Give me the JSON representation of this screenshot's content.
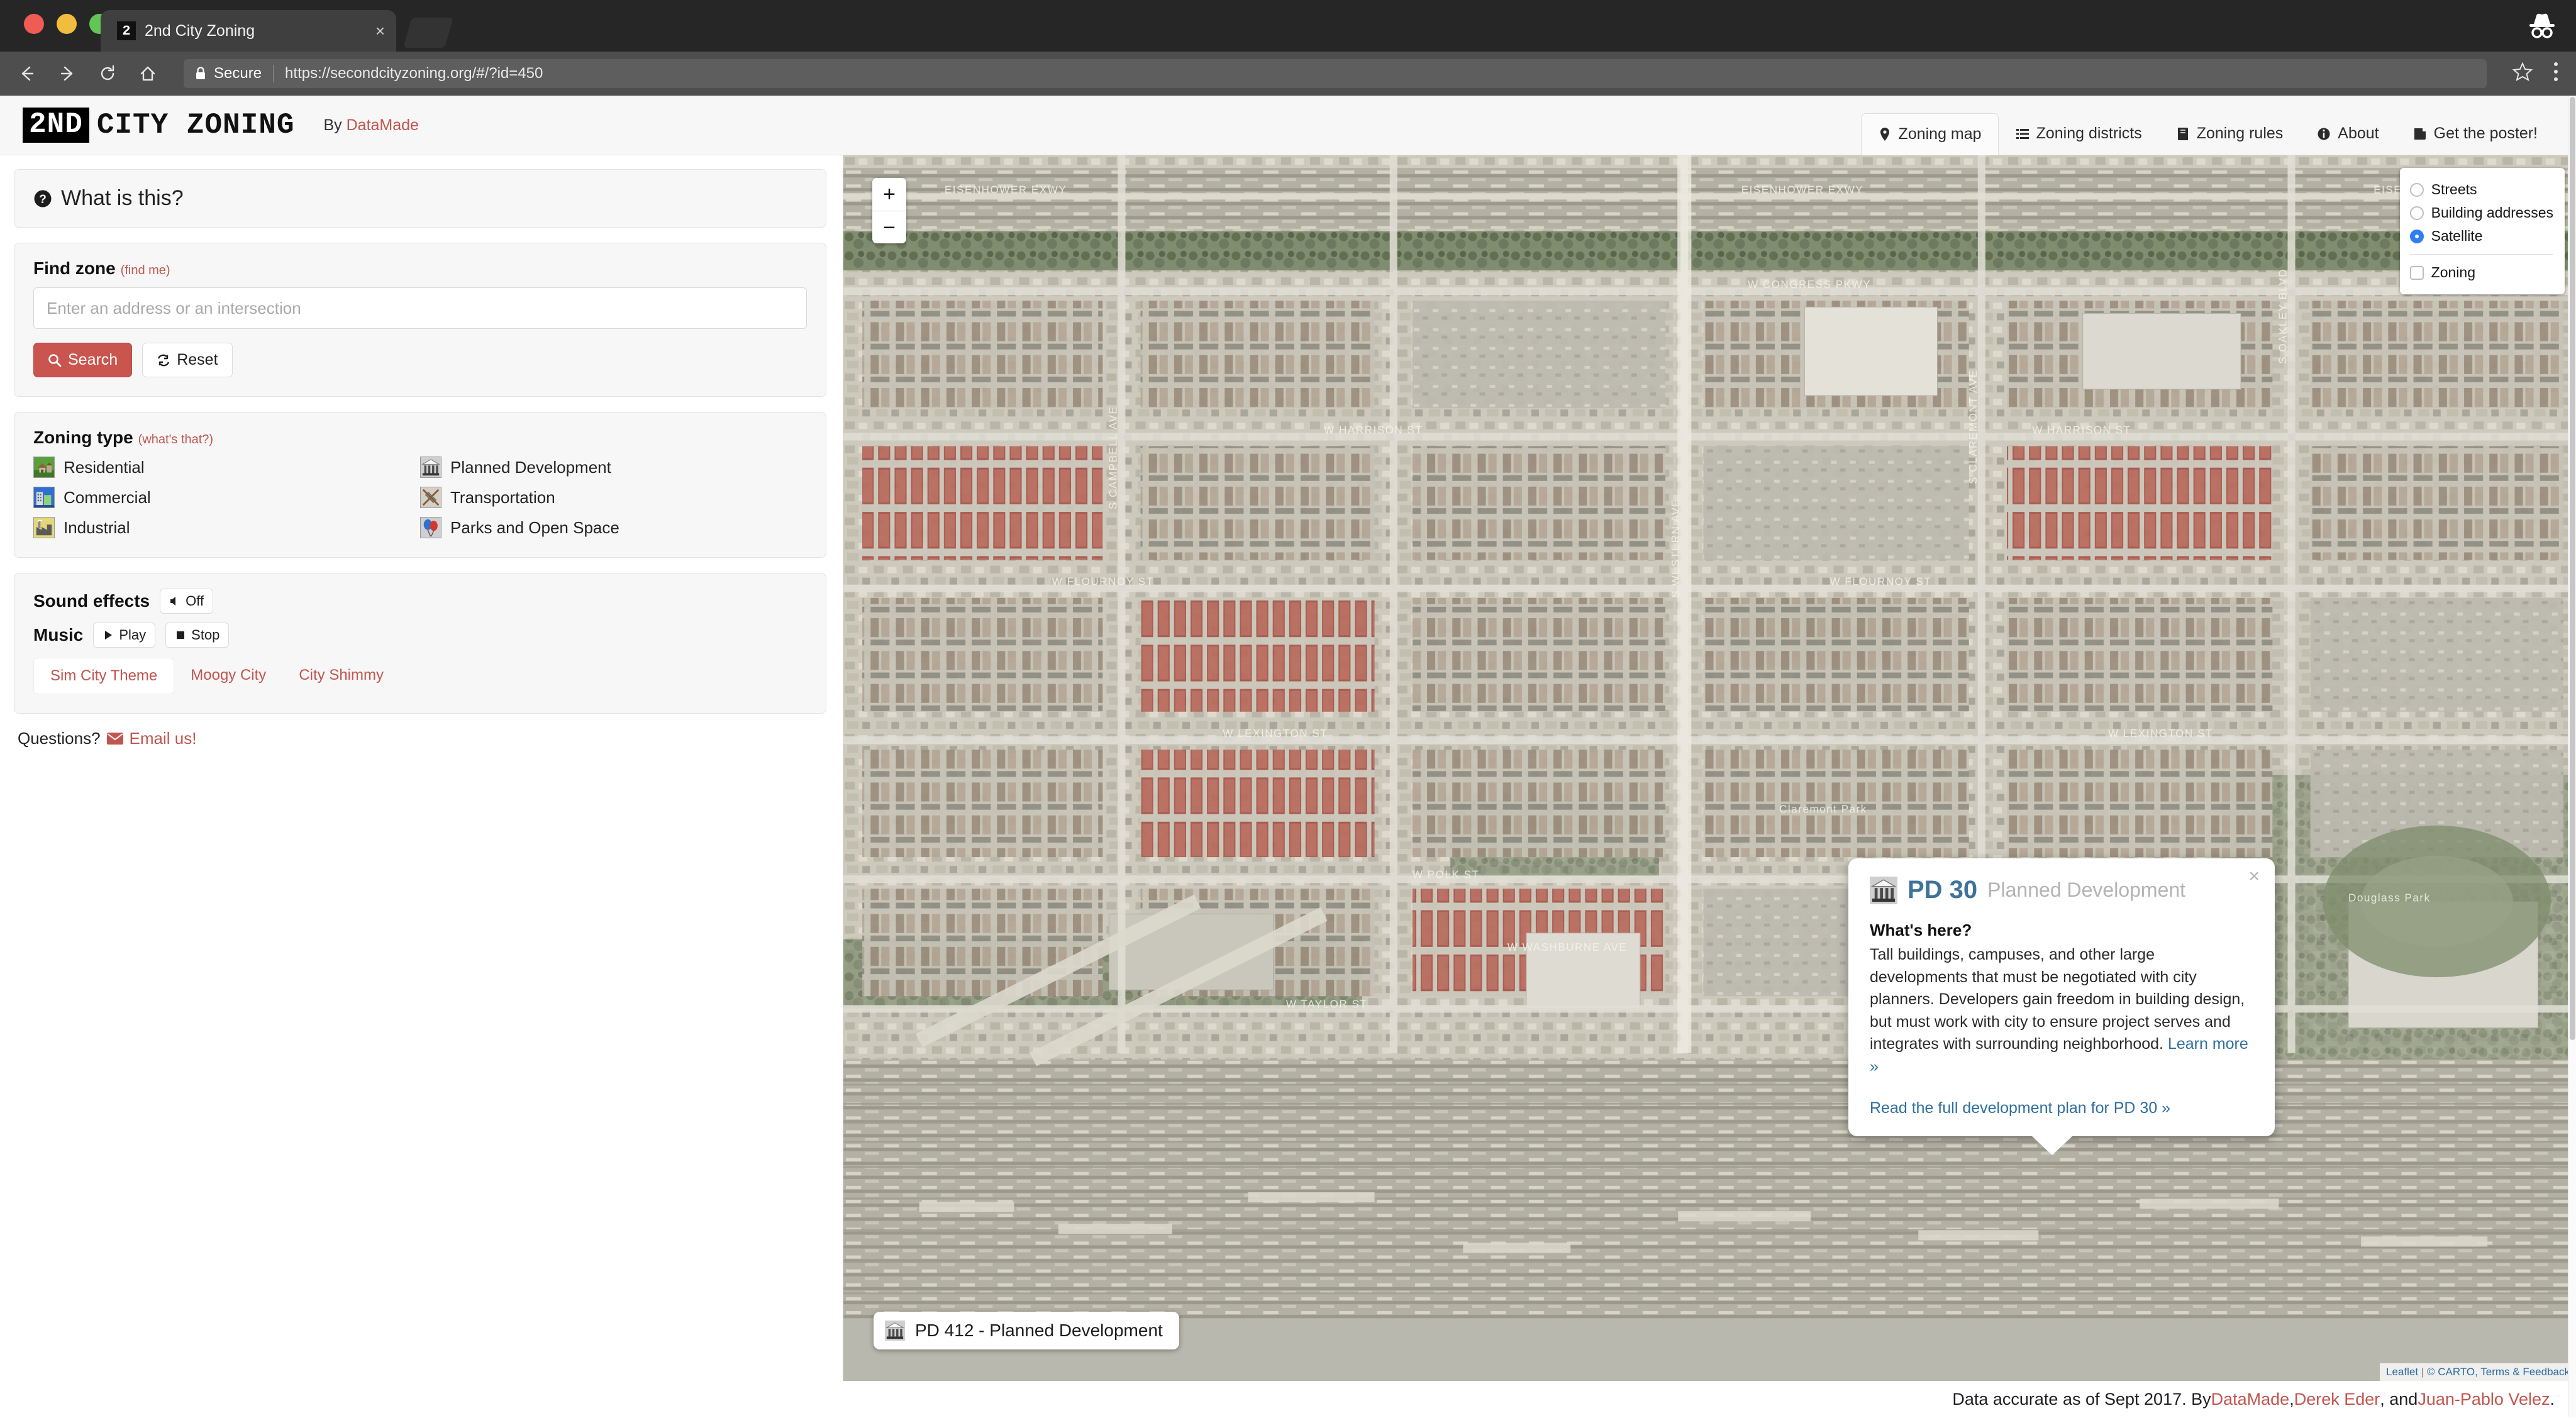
{
  "browser": {
    "tab": {
      "title": "2nd City Zoning",
      "favicon_text": "2",
      "close_label": "×"
    },
    "toolbar": {
      "back_icon": "back-arrow-icon",
      "forward_icon": "forward-arrow-icon",
      "reload_icon": "reload-icon",
      "home_icon": "home-icon",
      "secure_label": "Secure",
      "url": "https://secondcityzoning.org/#/?id=450",
      "star_icon": "bookmark-star-icon",
      "menu_icon": "three-dot-menu-icon"
    },
    "incognito_icon": "incognito-icon"
  },
  "header": {
    "logo_box": "2ND",
    "logo_text": "CITY ZONING",
    "by_prefix": "By ",
    "by_link": "DataMade",
    "nav": [
      {
        "label": "Zoning map",
        "icon": "map-pin-icon",
        "active": true
      },
      {
        "label": "Zoning districts",
        "icon": "list-icon",
        "active": false
      },
      {
        "label": "Zoning rules",
        "icon": "book-icon",
        "active": false
      },
      {
        "label": "About",
        "icon": "info-circle-icon",
        "active": false
      },
      {
        "label": "Get the poster!",
        "icon": "newspaper-icon",
        "active": false
      }
    ]
  },
  "sidebar": {
    "what_is_this": "What is this?",
    "find_zone": {
      "label": "Find zone",
      "sub_link": "(find me)",
      "placeholder": "Enter an address or an intersection",
      "value": "",
      "search_label": "Search",
      "reset_label": "Reset"
    },
    "zoning_type": {
      "label": "Zoning type",
      "sub_link": "(what's that?)",
      "items": [
        {
          "label": "Residential",
          "icon": "residential-icon"
        },
        {
          "label": "Planned Development",
          "icon": "planned-development-icon"
        },
        {
          "label": "Commercial",
          "icon": "commercial-icon"
        },
        {
          "label": "Transportation",
          "icon": "transportation-icon"
        },
        {
          "label": "Industrial",
          "icon": "industrial-icon"
        },
        {
          "label": "Parks and Open Space",
          "icon": "parks-icon"
        }
      ]
    },
    "sound": {
      "sfx_label": "Sound effects",
      "sfx_state": "Off",
      "music_label": "Music",
      "play_label": "Play",
      "stop_label": "Stop",
      "tracks": [
        {
          "label": "Sim City Theme",
          "active": true
        },
        {
          "label": "Moogy City",
          "active": false
        },
        {
          "label": "City Shimmy",
          "active": false
        }
      ]
    },
    "questions": {
      "text": "Questions?",
      "link": "Email us!",
      "icon": "envelope-icon"
    }
  },
  "map": {
    "zoom_in": "+",
    "zoom_out": "−",
    "layers": {
      "radios": [
        {
          "label": "Streets",
          "selected": false
        },
        {
          "label": "Building addresses",
          "selected": false
        },
        {
          "label": "Satellite",
          "selected": true
        }
      ],
      "checkboxes": [
        {
          "label": "Zoning",
          "checked": false
        }
      ]
    },
    "popup": {
      "close": "×",
      "icon": "planned-development-icon",
      "code": "PD 30",
      "kind": "Planned Development",
      "subhead": "What's here?",
      "body": "Tall buildings, campuses, and other large developments that must be negotiated with city planners. Developers gain freedom in building design, but must work with city to ensure project serves and integrates with surrounding neighborhood. ",
      "learn_more": "Learn more »",
      "plan_link": "Read the full development plan for PD 30 »"
    },
    "tooltip": {
      "icon": "planned-development-icon",
      "label": "PD 412 - Planned Development"
    },
    "attribution": {
      "leaflet": "Leaflet",
      "sep": "|",
      "carto": "© CARTO",
      "terms": "Terms & Feedback"
    }
  },
  "footer": {
    "text": "Data accurate as of Sept 2017. By ",
    "link1": "DataMade",
    "mid1": ", ",
    "link2": "Derek Eder",
    "mid2": ", and ",
    "link3": "Juan-Pablo Velez",
    "end": "."
  },
  "colors": {
    "brand_red": "#c0564f",
    "primary_btn": "#c9554e",
    "popup_blue": "#3e7299",
    "radio_blue": "#2f7ef3"
  }
}
